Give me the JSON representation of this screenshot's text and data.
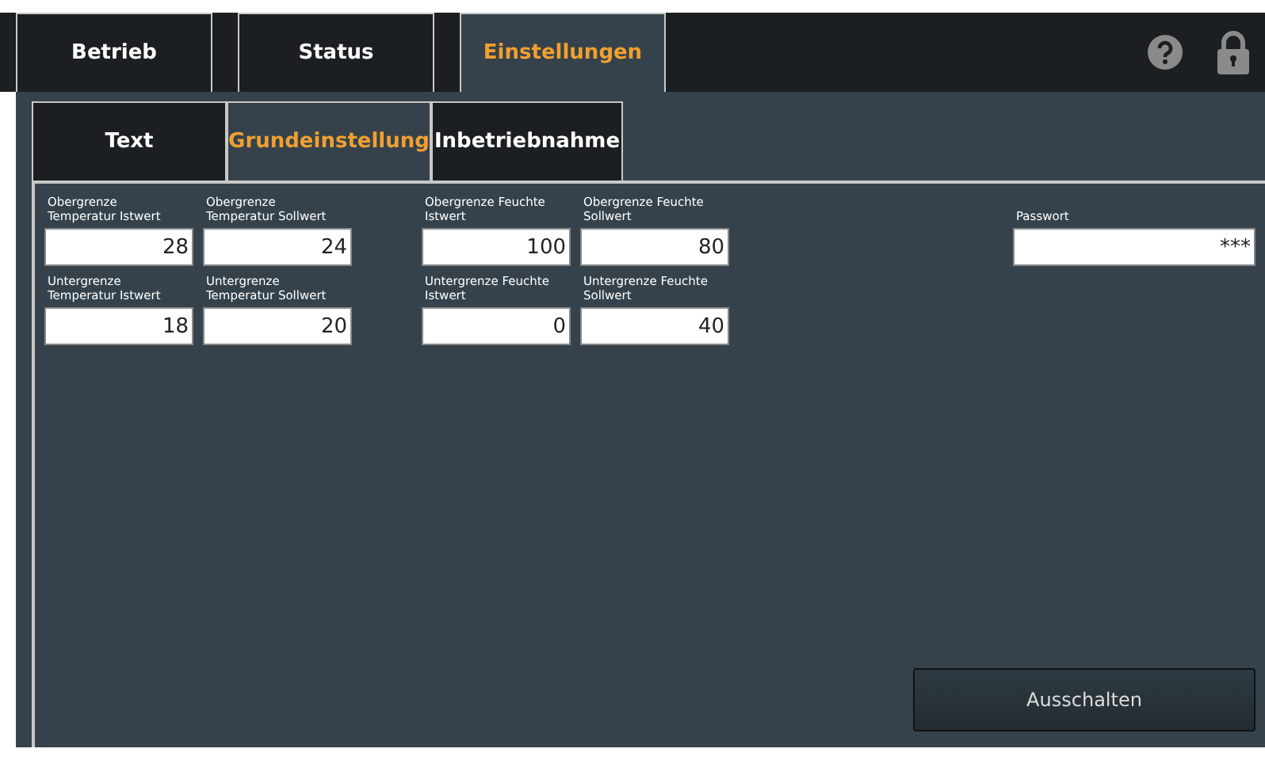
{
  "tabs": [
    {
      "label": "Betrieb",
      "selected": false
    },
    {
      "label": "Status",
      "selected": false
    },
    {
      "label": "Einstellungen",
      "selected": true
    }
  ],
  "subtabs": [
    {
      "label": "Text",
      "selected": false
    },
    {
      "label": "Grundeinstellung",
      "selected": true
    },
    {
      "label": "Inbetriebnahme",
      "selected": false
    }
  ],
  "field_rows": [
    [
      {
        "label": "Obergrenze\nTemperatur Istwert",
        "value": "28"
      },
      {
        "label": "Obergrenze\nTemperatur Sollwert",
        "value": "24"
      },
      {
        "label": "Obergrenze Feuchte\nIstwert",
        "value": "100"
      },
      {
        "label": "Obergrenze Feuchte\nSollwert",
        "value": "80"
      }
    ],
    [
      {
        "label": "Untergrenze\nTemperatur Istwert",
        "value": "18"
      },
      {
        "label": "Untergrenze\nTemperatur Sollwert",
        "value": "20"
      },
      {
        "label": "Untergrenze Feuchte\nIstwert",
        "value": "0"
      },
      {
        "label": "Untergrenze Feuchte\nSollwert",
        "value": "40"
      }
    ]
  ],
  "password": {
    "label": "Passwort",
    "value": "***"
  },
  "button": "Ausschalten"
}
